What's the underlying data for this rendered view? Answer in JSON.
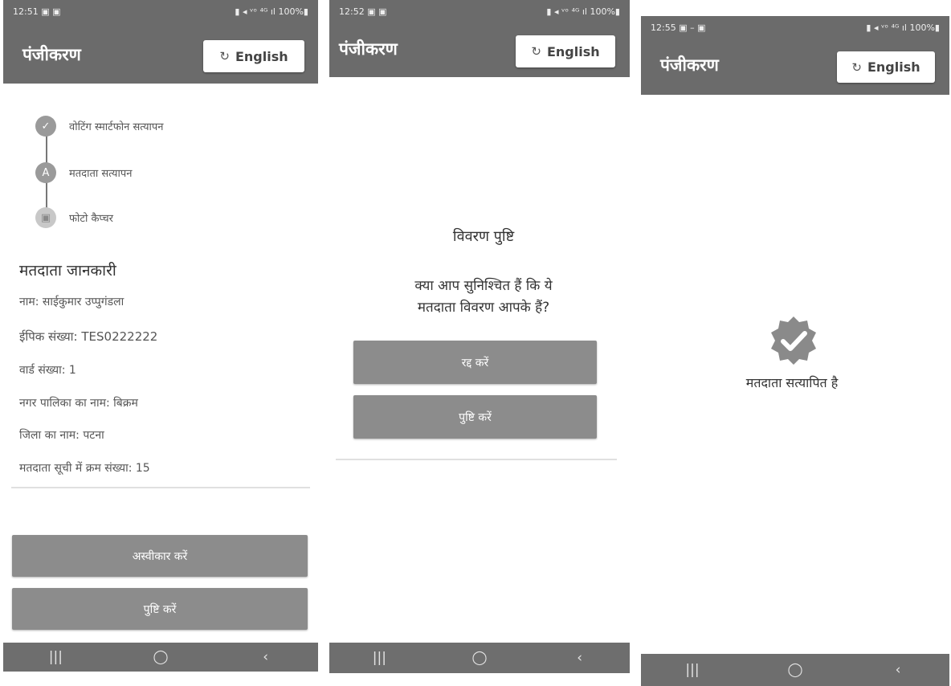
{
  "screens": [
    {
      "status": {
        "time": "12:51 ▣ ▣",
        "icons": "▮ ◂ ᵛᵒ ⁴ᴳ ıl 100%▮"
      },
      "app_title": "पंजीकरण",
      "lang_button": "English",
      "steps": [
        "वोटिंग स्मार्टफोन सत्यापन",
        "मतदाता सत्यापन",
        "फोटो कैप्चर"
      ],
      "step_icons": [
        "✓",
        "A",
        "▣"
      ],
      "section_title": "मतदाता जानकारी",
      "info": [
        "नाम: साईकुमार उप्पुगंडला",
        "ईपिक संख्या: TES0222222",
        "वार्ड संख्या: 1",
        "नगर पालिका का नाम: बिक्रम",
        "जिला का नाम: पटना",
        "मतदाता सूची में क्रम संख्या: 15"
      ],
      "reject_button": "अस्वीकार करें",
      "confirm_button": "पुष्टि करें"
    },
    {
      "status": {
        "time": "12:52 ▣ ▣",
        "icons": "▮ ◂ ᵛᵒ ⁴ᴳ ıl 100%▮"
      },
      "app_title": "पंजीकरण",
      "lang_button": "English",
      "dialog_title": "विवरण पुष्टि",
      "dialog_message_line1": "क्या आप सुनिश्चित हैं कि ये",
      "dialog_message_line2": "मतदाता विवरण आपके हैं?",
      "cancel_button": "रद्द करें",
      "confirm_button": "पुष्टि करें"
    },
    {
      "status": {
        "time": "12:55 ▣ – ▣",
        "icons": "▮ ◂ ᵛᵒ ⁴ᴳ ıl 100%▮"
      },
      "app_title": "पंजीकरण",
      "lang_button": "English",
      "verified_text": "मतदाता सत्यापित है"
    }
  ],
  "nav": {
    "recent": "|||",
    "home": "◯",
    "back": "‹"
  },
  "icons": {
    "refresh": "↻",
    "check": "✓"
  },
  "colors": {
    "appbar": "#6b6b6b",
    "button": "#8c8c8c",
    "navbar": "#6e6e6e"
  }
}
